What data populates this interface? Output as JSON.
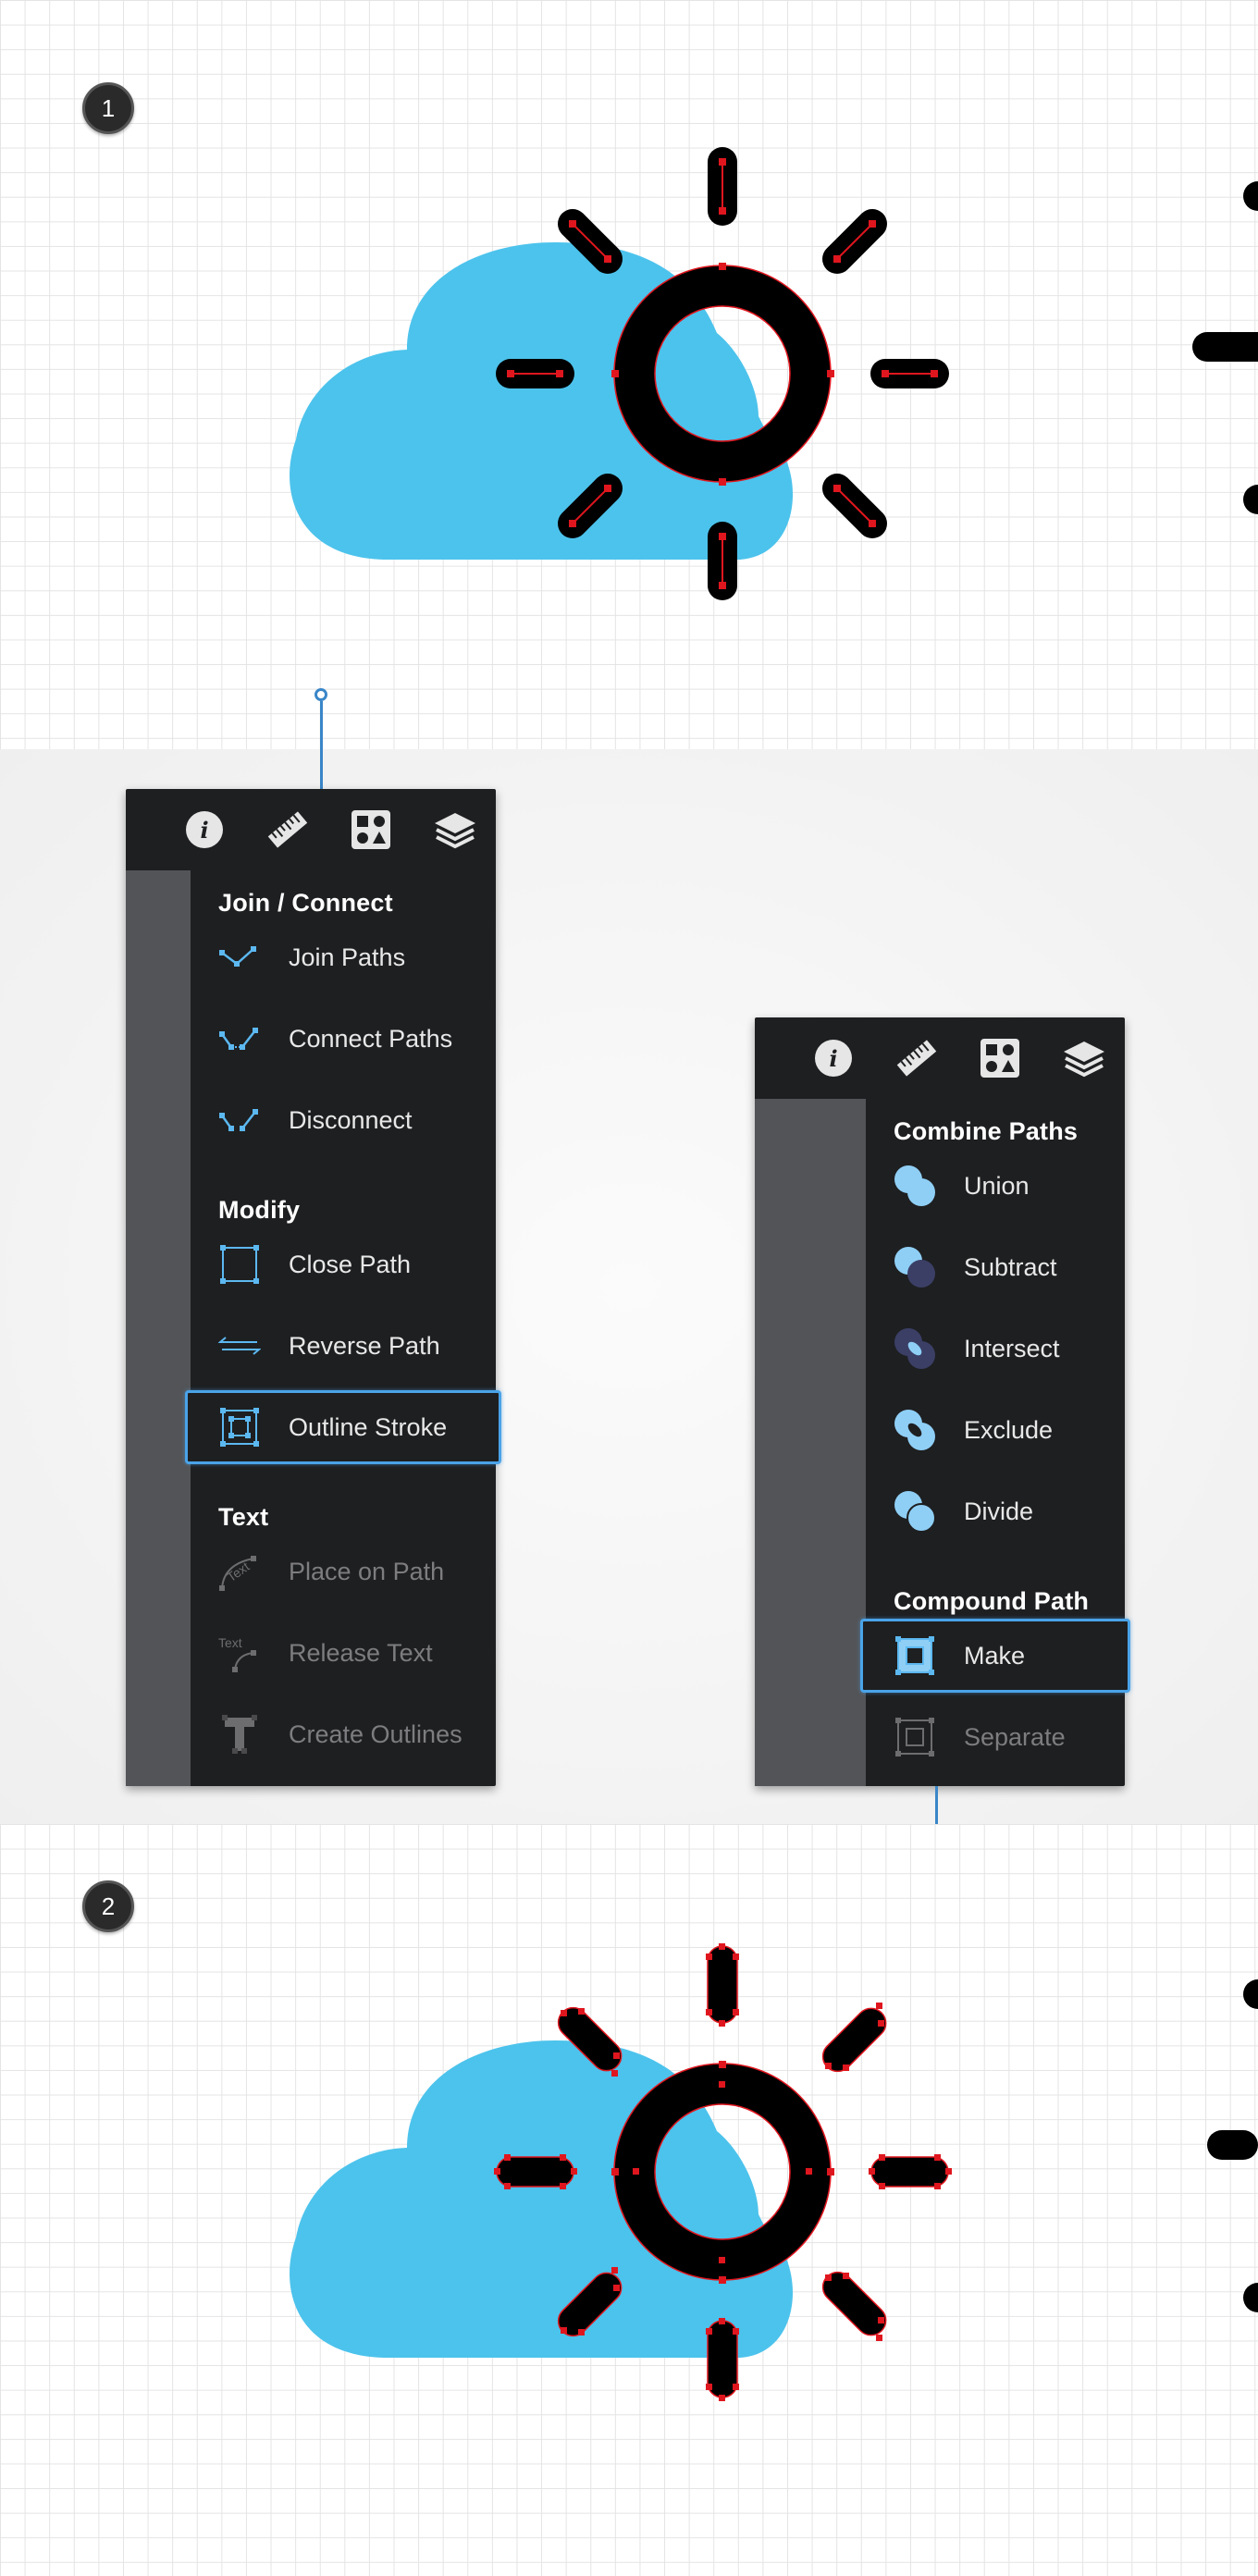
{
  "steps": {
    "first": "1",
    "second": "2"
  },
  "panel_left": {
    "toolbar_icons": [
      "info-icon",
      "ruler-icon",
      "shapes-icon",
      "layers-icon"
    ],
    "sections": [
      {
        "title": "Join / Connect",
        "items": [
          {
            "label": "Join Paths",
            "icon": "join-paths-icon",
            "enabled": true
          },
          {
            "label": "Connect Paths",
            "icon": "connect-paths-icon",
            "enabled": true
          },
          {
            "label": "Disconnect",
            "icon": "disconnect-icon",
            "enabled": true
          }
        ]
      },
      {
        "title": "Modify",
        "items": [
          {
            "label": "Close Path",
            "icon": "close-path-icon",
            "enabled": true
          },
          {
            "label": "Reverse Path",
            "icon": "reverse-path-icon",
            "enabled": true
          },
          {
            "label": "Outline Stroke",
            "icon": "outline-stroke-icon",
            "enabled": true,
            "selected": true
          }
        ]
      },
      {
        "title": "Text",
        "items": [
          {
            "label": "Place on Path",
            "icon": "place-on-path-icon",
            "enabled": false
          },
          {
            "label": "Release Text",
            "icon": "release-text-icon",
            "enabled": false
          },
          {
            "label": "Create Outlines",
            "icon": "create-outlines-icon",
            "enabled": false
          }
        ]
      }
    ]
  },
  "panel_right": {
    "toolbar_icons": [
      "info-icon",
      "ruler-icon",
      "shapes-icon",
      "layers-icon"
    ],
    "sections": [
      {
        "title": "Combine Paths",
        "items": [
          {
            "label": "Union",
            "icon": "union-icon",
            "enabled": true
          },
          {
            "label": "Subtract",
            "icon": "subtract-icon",
            "enabled": true
          },
          {
            "label": "Intersect",
            "icon": "intersect-icon",
            "enabled": true
          },
          {
            "label": "Exclude",
            "icon": "exclude-icon",
            "enabled": true
          },
          {
            "label": "Divide",
            "icon": "divide-icon",
            "enabled": true
          }
        ]
      },
      {
        "title": "Compound Path",
        "items": [
          {
            "label": "Make",
            "icon": "make-compound-icon",
            "enabled": true,
            "selected": true
          },
          {
            "label": "Separate",
            "icon": "separate-compound-icon",
            "enabled": false
          }
        ]
      }
    ]
  },
  "colors": {
    "cloud": "#4cc3ec",
    "panel_bg": "#1e1f21",
    "panel_sidebar": "#535457",
    "accent": "#4aa3e8",
    "anchor": "#e0161e"
  },
  "text_fragments": {
    "place_on_path_glyph": "Text",
    "release_text_glyph": "Text"
  }
}
